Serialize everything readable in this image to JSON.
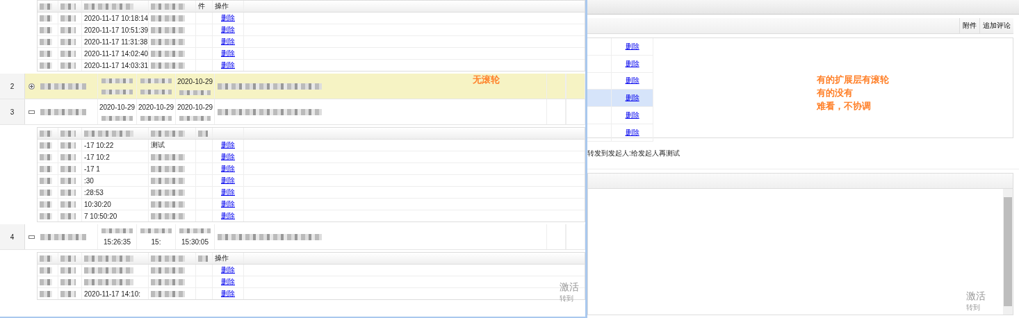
{
  "grid_window": {
    "top_subtable": {
      "header": {
        "column_5": "件",
        "column_6": "操作"
      },
      "rows": [
        {
          "column_3": "2020-11-17 10:18:14",
          "link": "删除"
        },
        {
          "column_3": "2020-11-17 10:51:39",
          "link": "删除"
        },
        {
          "column_3": "2020-11-17 11:31:38",
          "link": "删除"
        },
        {
          "column_3": "2020-11-17 14:02:40",
          "link": "删除"
        },
        {
          "column_3": "2020-11-17 14:03:31",
          "link": "删除"
        }
      ]
    },
    "rows": [
      {
        "number": "2",
        "expanded": false,
        "selected": true,
        "line_1": {
          "column_5": "2020-10-29"
        }
      },
      {
        "number": "3",
        "expanded": true,
        "selected": false,
        "line_1": {
          "column_3": "2020-10-29",
          "column_4": "2020-10-29",
          "column_5": "2020-10-29"
        },
        "subtable": {
          "rows": [
            {
              "column_3": "-17 10:22",
              "column_4": "测试",
              "link": "删除"
            },
            {
              "column_3": "-17 10:2",
              "link": "删除"
            },
            {
              "column_3": "-17 1",
              "link": "删除"
            },
            {
              "column_3": ":30",
              "link": "删除"
            },
            {
              "column_3": ":28:53",
              "link": "删除"
            },
            {
              "column_3": "10:30:20",
              "link": "删除"
            },
            {
              "column_3": "7 10:50:20",
              "link": "删除"
            }
          ]
        }
      },
      {
        "number": "4",
        "expanded": true,
        "selected": false,
        "line_2": {
          "column_3": "15:26:35",
          "column_4": "15:",
          "column_5": "15:30:05"
        },
        "subtable": {
          "header": {
            "column_6": "操作"
          },
          "rows": [
            {
              "link": "删除"
            },
            {
              "link": "删除"
            },
            {
              "column_3": "2020-11-17 14:10:",
              "link": "删除"
            }
          ]
        }
      }
    ],
    "activation_notice": {
      "title": "激活",
      "subtitle": "转到"
    }
  },
  "detail_window": {
    "toolbar": [
      "附件",
      "追加评论"
    ],
    "rows": [
      {
        "link": "删除",
        "selected": false
      },
      {
        "link": "删除",
        "selected": false
      },
      {
        "link": "删除",
        "selected": false
      },
      {
        "link": "删除",
        "selected": true
      },
      {
        "link": "删除",
        "selected": false
      },
      {
        "link": "删除",
        "selected": false
      }
    ],
    "comment": "转发到发起人:给发起人再测试",
    "activation_notice": {
      "title": "激活",
      "subtitle": "转到"
    }
  },
  "annotations": [
    {
      "lines": [
        "无滚轮"
      ]
    },
    {
      "lines": [
        "有的扩展层有滚轮",
        "有的没有",
        "难看，不协调"
      ]
    }
  ]
}
